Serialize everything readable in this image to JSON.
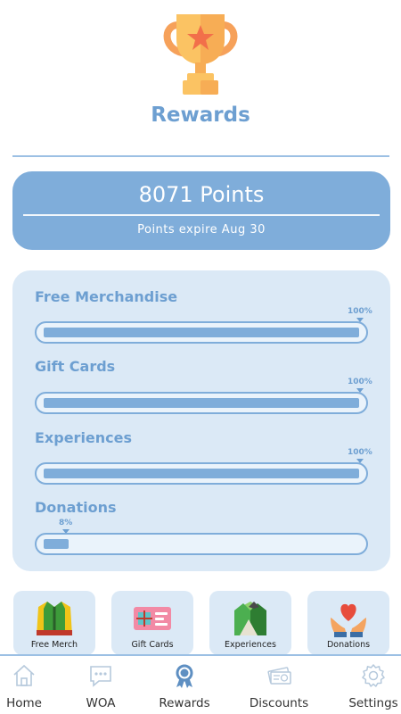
{
  "header": {
    "title": "Rewards",
    "icon": "trophy-icon"
  },
  "points": {
    "value": "8071 Points",
    "expiry": "Points expire Aug 30"
  },
  "categories": [
    {
      "label": "Free Merchandise",
      "percent_label": "100%",
      "progress": 1.0
    },
    {
      "label": "Gift Cards",
      "percent_label": "100%",
      "progress": 1.0
    },
    {
      "label": "Experiences",
      "percent_label": "100%",
      "progress": 1.0
    },
    {
      "label": "Donations",
      "percent_label": "8%",
      "progress": 0.08
    }
  ],
  "tiles": [
    {
      "label": "Free Merch",
      "icon": "jacket-icon"
    },
    {
      "label": "Gift Cards",
      "icon": "gift-card-icon"
    },
    {
      "label": "Experiences",
      "icon": "mountains-icon"
    },
    {
      "label": "Donations",
      "icon": "heart-hands-icon"
    }
  ],
  "nav": [
    {
      "label": "Home",
      "icon": "home-icon",
      "active": false
    },
    {
      "label": "WOA",
      "icon": "chat-bubble-icon",
      "active": false
    },
    {
      "label": "Rewards",
      "icon": "award-ribbon-icon",
      "active": true
    },
    {
      "label": "Discounts",
      "icon": "coupon-icon",
      "active": false
    },
    {
      "label": "Settings",
      "icon": "gear-icon",
      "active": false
    }
  ],
  "colors": {
    "accent": "#7fadda",
    "title": "#6d9fd1",
    "card_bg": "#dbe9f6",
    "trophy_gold": "#fbc363",
    "trophy_orange": "#f6a15a"
  }
}
